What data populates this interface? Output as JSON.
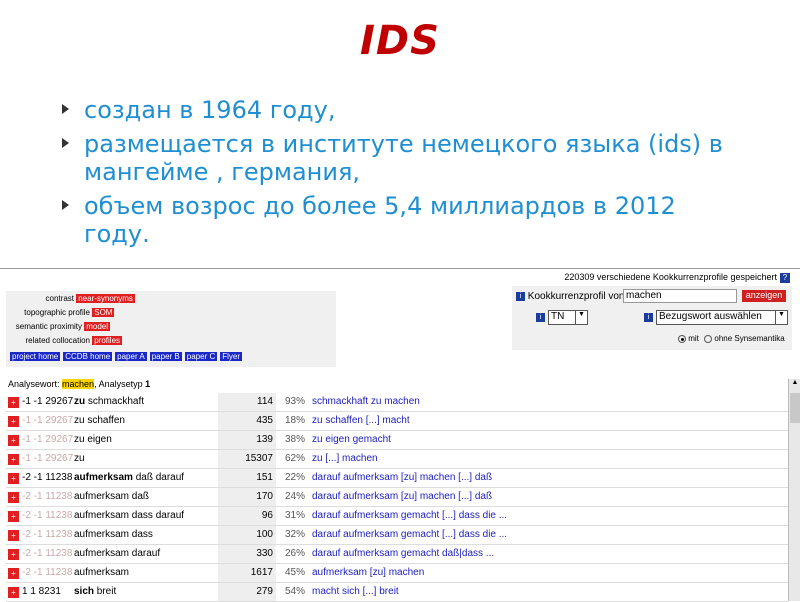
{
  "slide": {
    "title": "IDS",
    "bullets": [
      "создан в 1964 году,",
      "размещается в институте немецкого языка (ids) в мангейме , германия,",
      "объем возрос до более 5,4 миллиардов в 2012 году."
    ]
  },
  "app": {
    "status": "220309 verschiedene Kookkurrenzprofile gespeichert",
    "help_label": "?",
    "options": [
      {
        "label": "contrast",
        "chip": "near-synonyms"
      },
      {
        "label": "topographic profile",
        "chip": "SOM"
      },
      {
        "label": "semantic proximity",
        "chip": "model"
      },
      {
        "label": "related collocation",
        "chip": "profiles"
      }
    ],
    "links": [
      "project home",
      "CCDB home",
      "paper A",
      "paper B",
      "paper C",
      "Flyer"
    ],
    "profile_label": "Kookkurrenzprofil von",
    "profile_value": "machen",
    "show_button": "anzeigen",
    "tn_value": "TN",
    "bezug_value": "Bezugswort auswählen",
    "radio_mit": "mit",
    "radio_ohne": "ohne Synsemantika",
    "analysis_prefix": "Analysewort:",
    "analysis_word": "machen",
    "analysis_suffix": ", Analysetyp",
    "analysis_type": "1",
    "rows": [
      {
        "nums": "-1 -1 29267",
        "grey": false,
        "word_bold": "zu",
        "word_rest": " schmackhaft",
        "count": "114",
        "pct": "93%",
        "example": "schmackhaft zu machen"
      },
      {
        "nums": "-1 -1 29267",
        "grey": true,
        "word_bold": "",
        "word_rest": "zu schaffen",
        "count": "435",
        "pct": "18%",
        "example": "zu schaffen [...] macht"
      },
      {
        "nums": "-1 -1 29267",
        "grey": true,
        "word_bold": "",
        "word_rest": "zu eigen",
        "count": "139",
        "pct": "38%",
        "example": "zu eigen gemacht"
      },
      {
        "nums": "-1 -1 29267",
        "grey": true,
        "word_bold": "",
        "word_rest": "zu",
        "count": "15307",
        "pct": "62%",
        "example": "zu [...] machen"
      },
      {
        "nums": "-2 -1 11238",
        "grey": false,
        "word_bold": "aufmerksam",
        "word_rest": " daß darauf",
        "count": "151",
        "pct": "22%",
        "example": "darauf aufmerksam [zu] machen [...] daß"
      },
      {
        "nums": "-2 -1 11238",
        "grey": true,
        "word_bold": "",
        "word_rest": "aufmerksam daß",
        "count": "170",
        "pct": "24%",
        "example": "darauf aufmerksam [zu] machen [...] daß"
      },
      {
        "nums": "-2 -1 11238",
        "grey": true,
        "word_bold": "",
        "word_rest": "aufmerksam dass darauf",
        "count": "96",
        "pct": "31%",
        "example": "darauf aufmerksam gemacht [...] dass die ..."
      },
      {
        "nums": "-2 -1 11238",
        "grey": true,
        "word_bold": "",
        "word_rest": "aufmerksam dass",
        "count": "100",
        "pct": "32%",
        "example": "darauf aufmerksam gemacht [...] dass die ..."
      },
      {
        "nums": "-2 -1 11238",
        "grey": true,
        "word_bold": "",
        "word_rest": "aufmerksam darauf",
        "count": "330",
        "pct": "26%",
        "example": "darauf aufmerksam gemacht daß|dass ..."
      },
      {
        "nums": "-2 -1 11238",
        "grey": true,
        "word_bold": "",
        "word_rest": "aufmerksam",
        "count": "1617",
        "pct": "45%",
        "example": "aufmerksam [zu] machen"
      },
      {
        "nums": "1 1   8231",
        "grey": false,
        "word_bold": "sich",
        "word_rest": " breit",
        "count": "279",
        "pct": "54%",
        "example": "macht sich [...] breit"
      }
    ]
  },
  "colors": {
    "title": "#c00000",
    "bullets": "#1f8fd1",
    "chip_red": "#e02020",
    "chip_blue": "#1a28c8",
    "highlight": "#ffd400"
  }
}
